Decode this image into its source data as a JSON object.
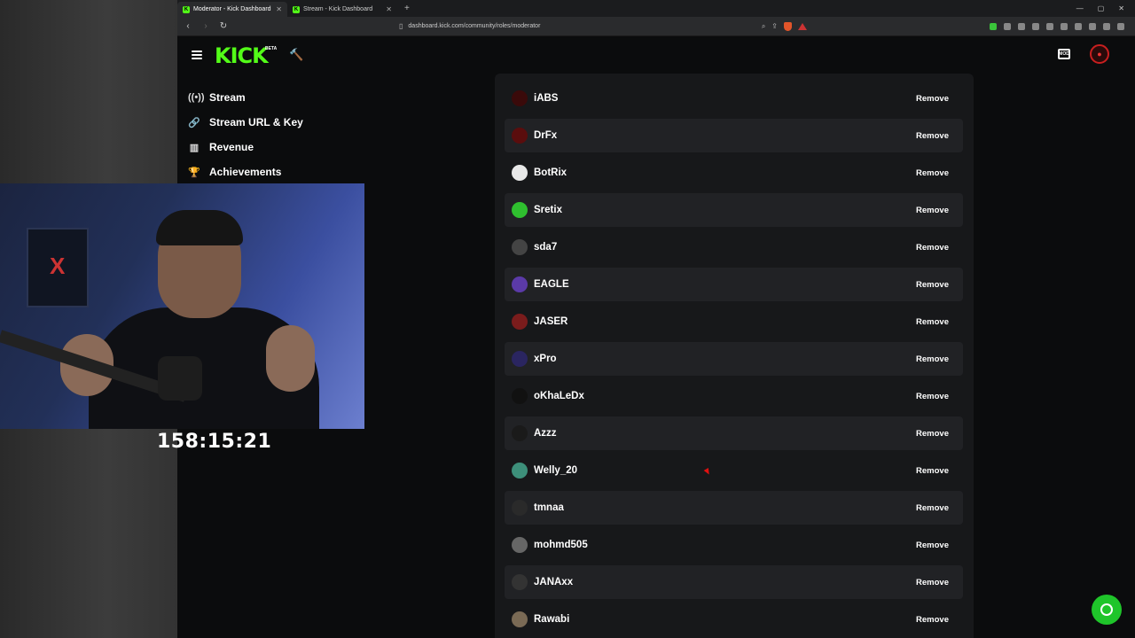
{
  "tabs": [
    {
      "title": "Moderator - Kick Dashboard",
      "active": true
    },
    {
      "title": "Stream - Kick Dashboard",
      "active": false
    }
  ],
  "address_bar": {
    "url": "dashboard.kick.com/community/roles/moderator"
  },
  "header": {
    "logo": "KICK",
    "badge": "BETA",
    "mod_label": "MOD"
  },
  "sidebar": {
    "items": [
      {
        "label": "Stream",
        "icon": "broadcast-icon"
      },
      {
        "label": "Stream URL & Key",
        "icon": "link-icon"
      },
      {
        "label": "Revenue",
        "icon": "chart-icon"
      },
      {
        "label": "Achievements",
        "icon": "trophy-icon"
      }
    ]
  },
  "moderators": {
    "remove_label": "Remove",
    "list": [
      {
        "name": "iABS",
        "avatar_color": "#3a0a0a"
      },
      {
        "name": "DrFx",
        "avatar_color": "#5a0d0d"
      },
      {
        "name": "BotRix",
        "avatar_color": "#e8e8e8"
      },
      {
        "name": "Sretix",
        "avatar_color": "#2fbf2f"
      },
      {
        "name": "sda7",
        "avatar_color": "#444444"
      },
      {
        "name": "EAGLE",
        "avatar_color": "#5b3aa8"
      },
      {
        "name": "JASER",
        "avatar_color": "#7a1c1c"
      },
      {
        "name": "xPro",
        "avatar_color": "#2a2560"
      },
      {
        "name": "oKhaLeDx",
        "avatar_color": "#111111"
      },
      {
        "name": "Azzz",
        "avatar_color": "#1a1a1a"
      },
      {
        "name": "Welly_20",
        "avatar_color": "#3d8f7a"
      },
      {
        "name": "tmnaa",
        "avatar_color": "#2a2a2a"
      },
      {
        "name": "mohmd505",
        "avatar_color": "#666666"
      },
      {
        "name": "JANAxx",
        "avatar_color": "#333333"
      },
      {
        "name": "Rawabi",
        "avatar_color": "#7a6a55"
      }
    ]
  },
  "overlay": {
    "timer": "158:15:21"
  },
  "colors": {
    "brand": "#53fc18",
    "page_bg": "#0b0c0d",
    "panel_bg": "#17181a",
    "row_alt_bg": "#212225",
    "help_button": "#1fc52a"
  }
}
